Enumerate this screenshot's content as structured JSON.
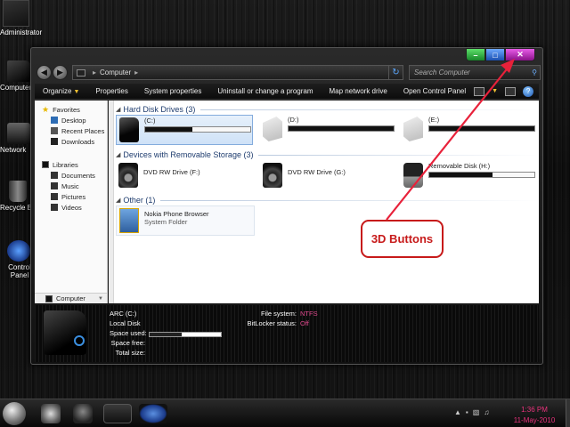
{
  "desktop": {
    "user": "Administrator",
    "icons": [
      "Computer",
      "Network",
      "Recycle Bin",
      "Control Panel"
    ]
  },
  "window": {
    "caption_buttons": {
      "min": "–",
      "max": "□",
      "close": "✕"
    },
    "address": {
      "crumb": "Computer"
    },
    "search_placeholder": "Search Computer",
    "toolbar": [
      "Organize",
      "Properties",
      "System properties",
      "Uninstall or change a program",
      "Map network drive",
      "Open Control Panel"
    ],
    "nav": {
      "favorites": {
        "label": "Favorites",
        "items": [
          "Desktop",
          "Recent Places",
          "Downloads"
        ]
      },
      "libraries": {
        "label": "Libraries",
        "items": [
          "Documents",
          "Music",
          "Pictures",
          "Videos"
        ]
      },
      "footer": "Computer"
    },
    "sections": {
      "hdd": {
        "title": "Hard Disk Drives (3)",
        "drives": [
          {
            "name": "(C:)",
            "fill": 0.45
          },
          {
            "name": "(D:)",
            "fill": 1.0
          },
          {
            "name": "(E:)",
            "fill": 1.0
          }
        ]
      },
      "removable": {
        "title": "Devices with Removable Storage (3)",
        "drives": [
          {
            "name": "DVD RW Drive (F:)"
          },
          {
            "name": "DVD RW Drive (G:)"
          },
          {
            "name": "Removable Disk (H:)",
            "fill": 0.6
          }
        ]
      },
      "other": {
        "title": "Other (1)",
        "items": [
          {
            "name": "Nokia Phone Browser",
            "sub": "System Folder"
          }
        ]
      }
    },
    "details": {
      "drive": "ARC (C:)",
      "type": "Local Disk",
      "space_used_label": "Space used:",
      "space_free_label": "Space free:",
      "total_size_label": "Total size:",
      "space_used_fill": 0.45,
      "fs_label": "File system:",
      "fs_value": "NTFS",
      "bitlocker_label": "BitLocker status:",
      "bitlocker_value": "Off"
    }
  },
  "annotation": {
    "text": "3D Buttons",
    "color": "#c71a1a"
  },
  "taskbar": {
    "time": "1:36 PM",
    "date": "11-May-2010"
  },
  "colors": {
    "accent_pink": "#e04a8e",
    "min_green": "#2ea83c",
    "max_blue": "#2a63c8",
    "close_magenta": "#b020b0"
  }
}
